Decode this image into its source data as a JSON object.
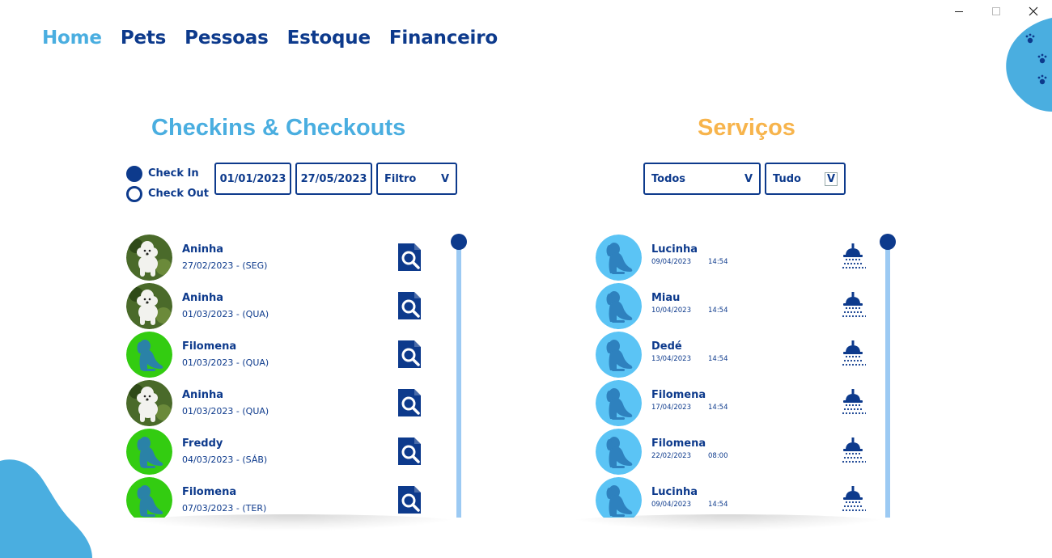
{
  "window": {
    "controls": [
      "minimize",
      "maximize",
      "close"
    ]
  },
  "nav": {
    "items": [
      {
        "label": "Home",
        "active": true
      },
      {
        "label": "Pets",
        "active": false
      },
      {
        "label": "Pessoas",
        "active": false
      },
      {
        "label": "Estoque",
        "active": false
      },
      {
        "label": "Financeiro",
        "active": false
      }
    ]
  },
  "checkins": {
    "title": "Checkins & Checkouts",
    "radio": {
      "check_in": {
        "label": "Check In",
        "checked": true
      },
      "check_out": {
        "label": "Check Out",
        "checked": false
      }
    },
    "date_from": "01/01/2023",
    "date_to": "27/05/2023",
    "filter": {
      "label": "Filtro",
      "arrow": "V"
    },
    "items": [
      {
        "name": "Aninha",
        "date": "27/02/2023 - (SEG)",
        "avatar": "poodle-photo"
      },
      {
        "name": "Aninha",
        "date": "01/03/2023 - (QUA)",
        "avatar": "poodle-photo"
      },
      {
        "name": "Filomena",
        "date": "01/03/2023 - (QUA)",
        "avatar": "dog-silhouette-green"
      },
      {
        "name": "Aninha",
        "date": "01/03/2023 - (QUA)",
        "avatar": "poodle-photo"
      },
      {
        "name": "Freddy",
        "date": "04/03/2023 - (SÁB)",
        "avatar": "dog-silhouette-green"
      },
      {
        "name": "Filomena",
        "date": "07/03/2023 - (TER)",
        "avatar": "dog-silhouette-green"
      }
    ],
    "scroll_position": 0
  },
  "servicos": {
    "title": "Serviços",
    "filter_type": {
      "label": "Todos",
      "arrow": "V"
    },
    "filter_period": {
      "label": "Tudo",
      "arrow": "V"
    },
    "items": [
      {
        "name": "Lucinha",
        "date": "09/04/2023",
        "time": "14:54"
      },
      {
        "name": "Miau",
        "date": "10/04/2023",
        "time": "14:54"
      },
      {
        "name": "Dedé",
        "date": "13/04/2023",
        "time": "14:54"
      },
      {
        "name": "Filomena",
        "date": "17/04/2023",
        "time": "14:54"
      },
      {
        "name": "Filomena",
        "date": "22/02/2023",
        "time": "08:00"
      },
      {
        "name": "Lucinha",
        "date": "09/04/2023",
        "time": "14:54"
      }
    ],
    "scroll_position": 0
  },
  "colors": {
    "primary": "#0d3a8c",
    "accent_blue": "#4aaee0",
    "accent_orange": "#f7b44c",
    "avatar_green": "#33cc11",
    "avatar_blue": "#5bc4f5",
    "scroll_track": "#9ccaf3"
  },
  "icons": {
    "checkin_item_action": "document-search-icon",
    "service_item_action": "shower-icon",
    "decoration": "paw-icon"
  }
}
